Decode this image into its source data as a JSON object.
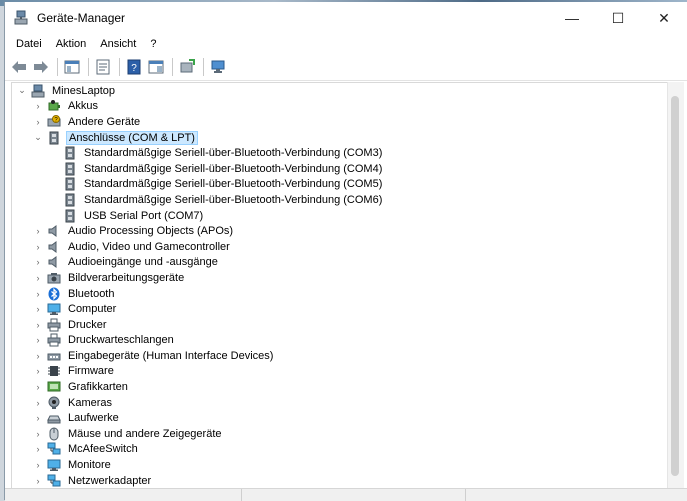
{
  "window": {
    "title": "Geräte-Manager",
    "minimize": "—",
    "maximize": "☐",
    "close": "✕"
  },
  "menu": [
    "Datei",
    "Aktion",
    "Ansicht",
    "?"
  ],
  "tree": {
    "root": "MinesLaptop",
    "items": [
      {
        "label": "Akkus",
        "icon": "battery-icon"
      },
      {
        "label": "Andere Geräte",
        "icon": "unknown-device-icon"
      },
      {
        "label": "Anschlüsse (COM & LPT)",
        "icon": "port-icon",
        "expanded": true,
        "selected": true,
        "children": [
          "Standardmäßgige Seriell-über-Bluetooth-Verbindung (COM3)",
          "Standardmäßgige Seriell-über-Bluetooth-Verbindung (COM4)",
          "Standardmäßgige Seriell-über-Bluetooth-Verbindung (COM5)",
          "Standardmäßgige Seriell-über-Bluetooth-Verbindung (COM6)",
          "USB Serial Port (COM7)"
        ]
      },
      {
        "label": "Audio Processing Objects (APOs)",
        "icon": "speaker-icon"
      },
      {
        "label": "Audio, Video und Gamecontroller",
        "icon": "speaker-icon"
      },
      {
        "label": "Audioeingänge und -ausgänge",
        "icon": "speaker-icon"
      },
      {
        "label": "Bildverarbeitungsgeräte",
        "icon": "imaging-icon"
      },
      {
        "label": "Bluetooth",
        "icon": "bluetooth-icon"
      },
      {
        "label": "Computer",
        "icon": "monitor-icon"
      },
      {
        "label": "Drucker",
        "icon": "printer-icon"
      },
      {
        "label": "Druckwarteschlangen",
        "icon": "printer-icon"
      },
      {
        "label": "Eingabegeräte (Human Interface Devices)",
        "icon": "hid-icon"
      },
      {
        "label": "Firmware",
        "icon": "firmware-icon"
      },
      {
        "label": "Grafikkarten",
        "icon": "display-adapter-icon"
      },
      {
        "label": "Kameras",
        "icon": "camera-icon"
      },
      {
        "label": "Laufwerke",
        "icon": "drive-icon"
      },
      {
        "label": "Mäuse und andere Zeigegeräte",
        "icon": "mouse-icon"
      },
      {
        "label": "McAfeeSwitch",
        "icon": "network-icon"
      },
      {
        "label": "Monitore",
        "icon": "monitor-icon"
      },
      {
        "label": "Netzwerkadapter",
        "icon": "network-icon"
      }
    ]
  },
  "colors": {
    "selection": "#cce8ff",
    "selection_border": "#99d1ff",
    "bluetooth": "#1a6fd6"
  }
}
